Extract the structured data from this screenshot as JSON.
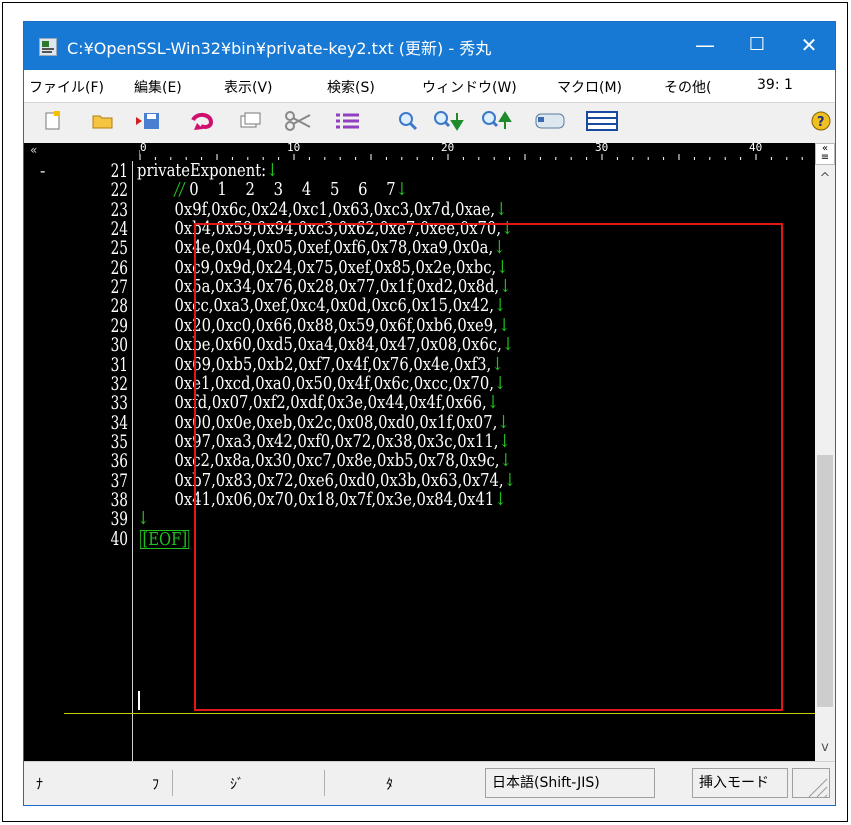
{
  "window": {
    "title": "C:¥OpenSSL-Win32¥bin¥private-key2.txt (更新) - 秀丸",
    "minimize": "—",
    "maximize": "☐",
    "close": "✕"
  },
  "menu": [
    "ファイル(F)",
    "編集(E)",
    "表示(V)",
    "検索(S)",
    "ウィンドウ(W)",
    "マクロ(M)",
    "その他(",
    "39: 1"
  ],
  "toolbar_icons": [
    "new-file-icon",
    "open-folder-icon",
    "save-icon",
    "undo-icon",
    "copy-icon",
    "cut-icon",
    "paste-icon",
    "search-icon",
    "find-next-icon",
    "find-prev-icon",
    "tag-icon",
    "split-window-icon",
    "help-icon"
  ],
  "ruler": {
    "marks": [
      "0",
      "10",
      "20",
      "30",
      "40"
    ]
  },
  "editor": {
    "lines": [
      {
        "num": "21",
        "text": "privateExponent:",
        "eol": "↓",
        "fold": "-"
      },
      {
        "num": "22",
        "indent": "        ",
        "comment": "//",
        "text": " 0    1    2    3    4    5    6    7",
        "eol": "↓"
      },
      {
        "num": "23",
        "indent": "        ",
        "text": "0x9f,0x6c,0x24,0xc1,0x63,0xc3,0x7d,0xae,",
        "eol": "↓"
      },
      {
        "num": "24",
        "indent": "        ",
        "text": "0xb4,0x59,0x94,0xc3,0x62,0xe7,0xee,0x70,",
        "eol": "↓"
      },
      {
        "num": "25",
        "indent": "        ",
        "text": "0x4e,0x04,0x05,0xef,0xf6,0x78,0xa9,0x0a,",
        "eol": "↓"
      },
      {
        "num": "26",
        "indent": "        ",
        "text": "0xc9,0x9d,0x24,0x75,0xef,0x85,0x2e,0xbc,",
        "eol": "↓"
      },
      {
        "num": "27",
        "indent": "        ",
        "text": "0x5a,0x34,0x76,0x28,0x77,0x1f,0xd2,0x8d,",
        "eol": "↓"
      },
      {
        "num": "28",
        "indent": "        ",
        "text": "0xcc,0xa3,0xef,0xc4,0x0d,0xc6,0x15,0x42,",
        "eol": "↓"
      },
      {
        "num": "29",
        "indent": "        ",
        "text": "0x20,0xc0,0x66,0x88,0x59,0x6f,0xb6,0xe9,",
        "eol": "↓"
      },
      {
        "num": "30",
        "indent": "        ",
        "text": "0xbe,0x60,0xd5,0xa4,0x84,0x47,0x08,0x6c,",
        "eol": "↓"
      },
      {
        "num": "31",
        "indent": "        ",
        "text": "0x69,0xb5,0xb2,0xf7,0x4f,0x76,0x4e,0xf3,",
        "eol": "↓"
      },
      {
        "num": "32",
        "indent": "        ",
        "text": "0xe1,0xcd,0xa0,0x50,0x4f,0x6c,0xcc,0x70,",
        "eol": "↓"
      },
      {
        "num": "33",
        "indent": "        ",
        "text": "0xfd,0x07,0xf2,0xdf,0x3e,0x44,0x4f,0x66,",
        "eol": "↓"
      },
      {
        "num": "34",
        "indent": "        ",
        "text": "0x00,0x0e,0xeb,0x2c,0x08,0xd0,0x1f,0x07,",
        "eol": "↓"
      },
      {
        "num": "35",
        "indent": "        ",
        "text": "0x97,0xa3,0x42,0xf0,0x72,0x38,0x3c,0x11,",
        "eol": "↓"
      },
      {
        "num": "36",
        "indent": "        ",
        "text": "0xc2,0x8a,0x30,0xc7,0x8e,0xb5,0x78,0x9c,",
        "eol": "↓"
      },
      {
        "num": "37",
        "indent": "        ",
        "text": "0xb7,0x83,0x72,0xe6,0xd0,0x3b,0x63,0x74,",
        "eol": "↓"
      },
      {
        "num": "38",
        "indent": "        ",
        "text": "0x41,0x06,0x70,0x18,0x7f,0x3e,0x84,0x41",
        "eol": "↓"
      },
      {
        "num": "39",
        "text": "",
        "eol": "↓"
      },
      {
        "num": "40",
        "eof": "[EOF]"
      }
    ]
  },
  "statusbar": {
    "cells": [
      "ﾅ",
      "ﾌ",
      "ｼﾞ",
      "ﾀ"
    ],
    "encoding": "日本語(Shift-JIS)",
    "mode": "挿入モード"
  },
  "colors": {
    "titlebar": "#1779d4",
    "highlight_box": "#e01818",
    "eol_mark": "#20c020"
  }
}
